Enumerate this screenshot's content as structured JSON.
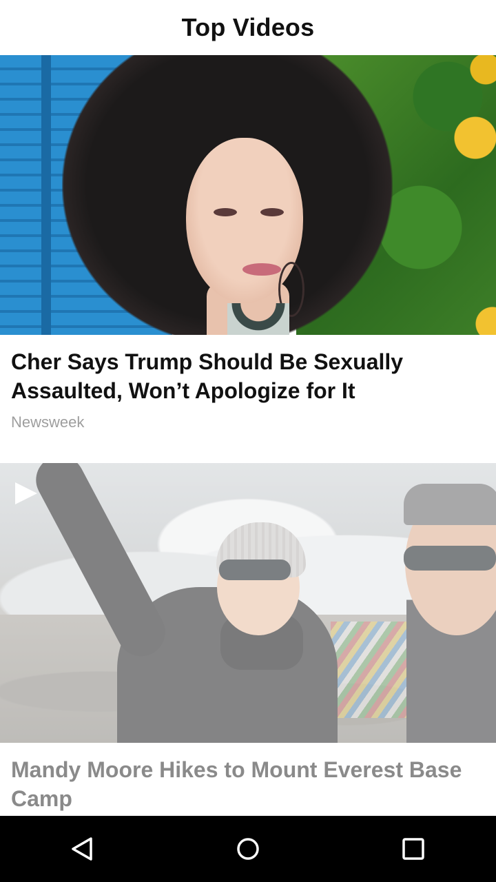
{
  "header": {
    "title": "Top Videos"
  },
  "feed": {
    "items": [
      {
        "headline": "Cher Says Trump Should Be Sexually Assaulted, Won’t Apologize for It",
        "source": "Newsweek"
      },
      {
        "headline": "Mandy Moore Hikes to Mount Everest Base Camp",
        "source": ""
      }
    ]
  },
  "icons": {
    "play": "play-icon",
    "back": "back-icon",
    "home": "home-icon",
    "recents": "recents-icon"
  },
  "colors": {
    "title": "#111111",
    "source": "#9e9e9e",
    "nav_bar": "#000000"
  }
}
